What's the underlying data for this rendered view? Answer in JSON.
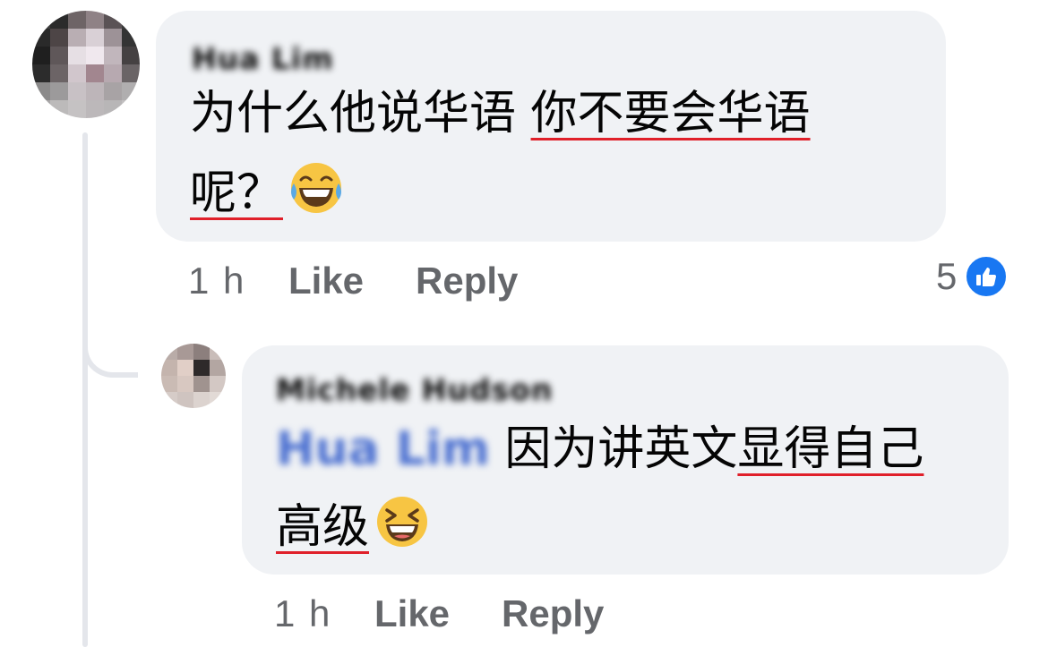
{
  "comment": {
    "author": "Hua Lim",
    "text_line1_a": "为什么他说华语 ",
    "text_line1_b": "你不要会华语",
    "text_line2": "呢？",
    "emoji": "joy-emoji",
    "time": "1 h",
    "like_label": "Like",
    "reply_label": "Reply",
    "reaction_count": "5",
    "reaction_icon": "thumbs-up-icon"
  },
  "reply": {
    "author": "Michele Hudson",
    "mention": "Hua Lim",
    "text_line1_a": " 因为讲英文",
    "text_line1_b": "显得自己",
    "text_line2": "高级",
    "emoji": "laughing-emoji",
    "time": "1 h",
    "like_label": "Like",
    "reply_label": "Reply"
  },
  "colors": {
    "bubble": "#f0f2f5",
    "meta_text": "#65676b",
    "like_blue": "#1877f2",
    "underline": "#e0202a",
    "thread_line": "#e4e6eb"
  }
}
